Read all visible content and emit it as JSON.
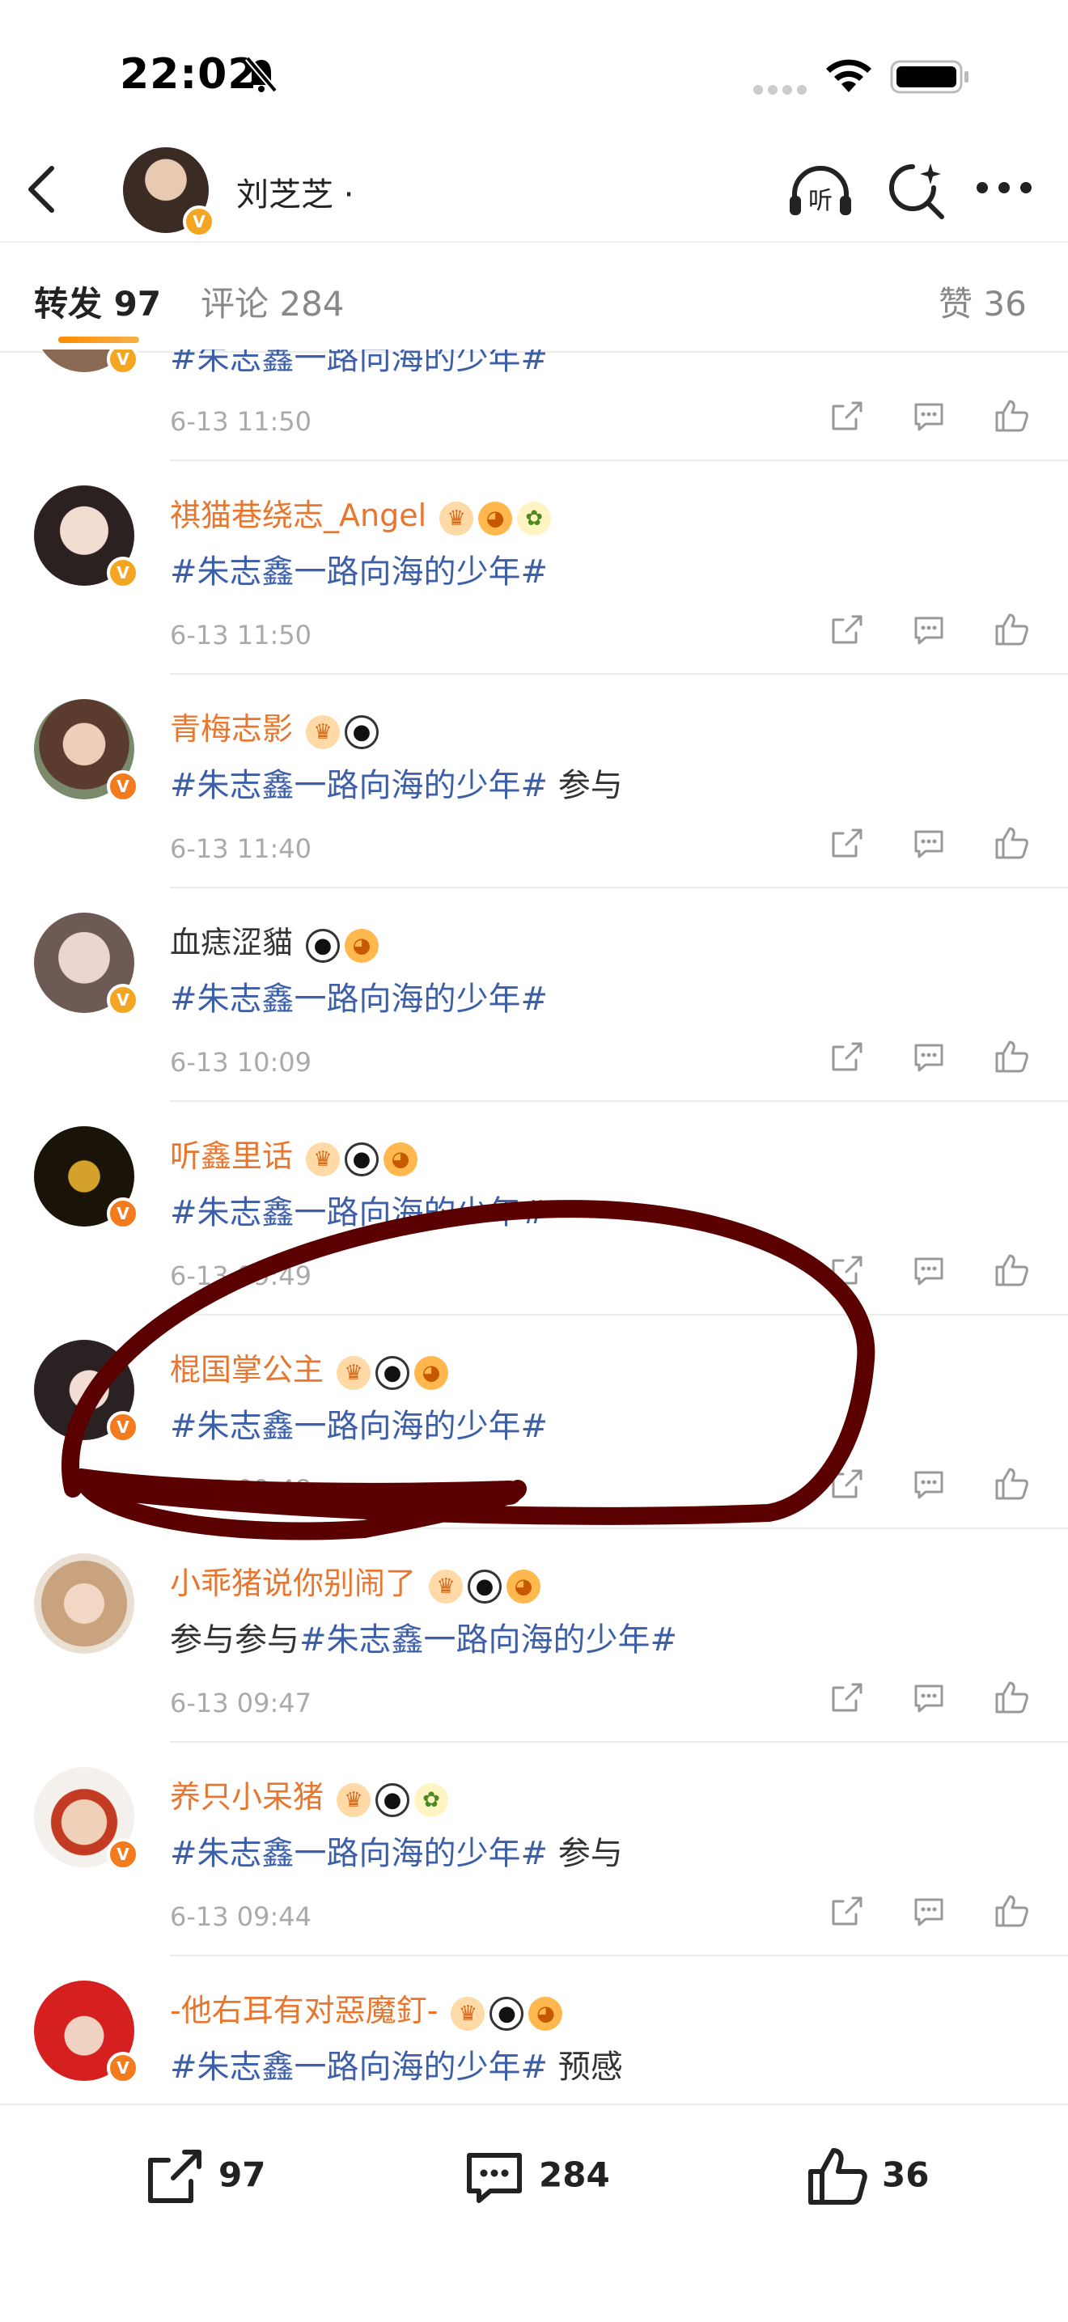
{
  "status_bar": {
    "time": "22:02"
  },
  "header": {
    "title": "刘芝芝 ·"
  },
  "tabs": {
    "repost": "转发 97",
    "comment": "评论 284",
    "like": "赞 36"
  },
  "reposts": [
    {
      "name": "",
      "text": "#朱志鑫一路向海的少年#",
      "topic": "#朱志鑫一路向海的少年#",
      "suffix": "",
      "time": "6-13 11:50",
      "badges": []
    },
    {
      "name": "祺猫巷绕志_Angel",
      "topic": "#朱志鑫一路向海的少年#",
      "suffix": "",
      "time": "6-13 11:50",
      "badges": [
        "crown",
        "fish",
        "flower"
      ]
    },
    {
      "name": "青梅志影",
      "topic": "#朱志鑫一路向海的少年#",
      "suffix": " 参与",
      "time": "6-13 11:40",
      "badges": [
        "crown",
        "panda"
      ]
    },
    {
      "name": "血痣涩貓",
      "topic": "#朱志鑫一路向海的少年#",
      "suffix": "",
      "time": "6-13 10:09",
      "badges": [
        "panda",
        "fish"
      ]
    },
    {
      "name": "听鑫里话",
      "topic": "#朱志鑫一路向海的少年#",
      "suffix": "",
      "time": "6-13 09:49",
      "badges": [
        "crown",
        "panda",
        "fish"
      ]
    },
    {
      "name": "棍国掌公主",
      "topic": "#朱志鑫一路向海的少年#",
      "suffix": "",
      "time": "6-13 09:48",
      "badges": [
        "crown",
        "panda",
        "fish"
      ]
    },
    {
      "name": "小乖猪说你别闹了",
      "prefix": "参与参与",
      "topic": "#朱志鑫一路向海的少年#",
      "suffix": "",
      "time": "6-13 09:47",
      "badges": [
        "crown",
        "panda",
        "fish"
      ]
    },
    {
      "name": "养只小呆猪",
      "topic": "#朱志鑫一路向海的少年#",
      "suffix": " 参与",
      "time": "6-13 09:44",
      "badges": [
        "crown",
        "panda",
        "flower"
      ]
    },
    {
      "name": "-他右耳有对惡魔釘-",
      "topic": "#朱志鑫一路向海的少年#",
      "suffix": " 预感",
      "time": "",
      "badges": [
        "crown",
        "panda",
        "fish"
      ]
    }
  ],
  "bottom_bar": {
    "repost_count": "97",
    "comment_count": "284",
    "like_count": "36"
  },
  "colors": {
    "accent": "#e8762e",
    "topic": "#3d5fa8",
    "annotation": "#5a0000"
  }
}
